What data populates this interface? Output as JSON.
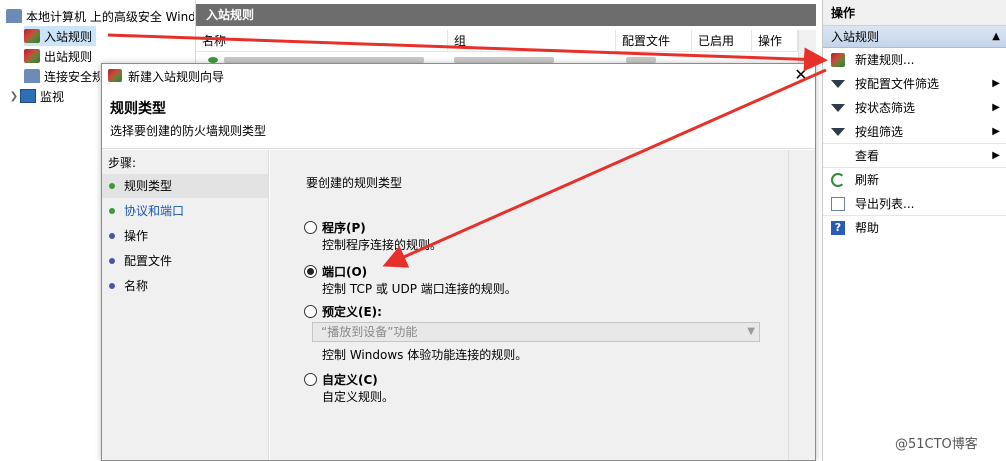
{
  "tree": {
    "items": [
      {
        "label": "本地计算机 上的高级安全 Windows"
      },
      {
        "label": "入站规则"
      },
      {
        "label": "出站规则"
      },
      {
        "label": "连接安全规则"
      },
      {
        "label": "监视"
      }
    ]
  },
  "list": {
    "title": "入站规则",
    "columns": [
      "名称",
      "组",
      "配置文件",
      "已启用",
      "操作"
    ]
  },
  "actions": {
    "header": "操作",
    "section": "入站规则",
    "items": [
      {
        "label": "新建规则...",
        "icon": "new-rule-icon"
      },
      {
        "label": "按配置文件筛选",
        "icon": "filter-icon"
      },
      {
        "label": "按状态筛选",
        "icon": "filter-icon"
      },
      {
        "label": "按组筛选",
        "icon": "filter-icon"
      },
      {
        "label": "查看",
        "icon": ""
      },
      {
        "label": "刷新",
        "icon": "refresh-icon"
      },
      {
        "label": "导出列表...",
        "icon": "export-icon"
      },
      {
        "label": "帮助",
        "icon": "help-icon"
      }
    ]
  },
  "wizard": {
    "title": "新建入站规则向导",
    "heading": "规则类型",
    "description": "选择要创建的防火墙规则类型",
    "steps_label": "步骤:",
    "steps": [
      "规则类型",
      "协议和端口",
      "操作",
      "配置文件",
      "名称"
    ],
    "prompt": "要创建的规则类型",
    "options": [
      {
        "label": "程序(P)",
        "desc": "控制程序连接的规则。",
        "checked": false
      },
      {
        "label": "端口(O)",
        "desc": "控制 TCP 或 UDP 端口连接的规则。",
        "checked": true
      },
      {
        "label": "预定义(E):",
        "desc": "控制 Windows 体验功能连接的规则。",
        "checked": false
      },
      {
        "label": "自定义(C)",
        "desc": "自定义规则。",
        "checked": false
      }
    ],
    "predefined_value": "“播放到设备”功能"
  },
  "colors": {
    "step_dot": "#3a9a3a",
    "arrow": "#e8302a",
    "link": "#1a56b2"
  },
  "watermark": "@51CTO博客"
}
